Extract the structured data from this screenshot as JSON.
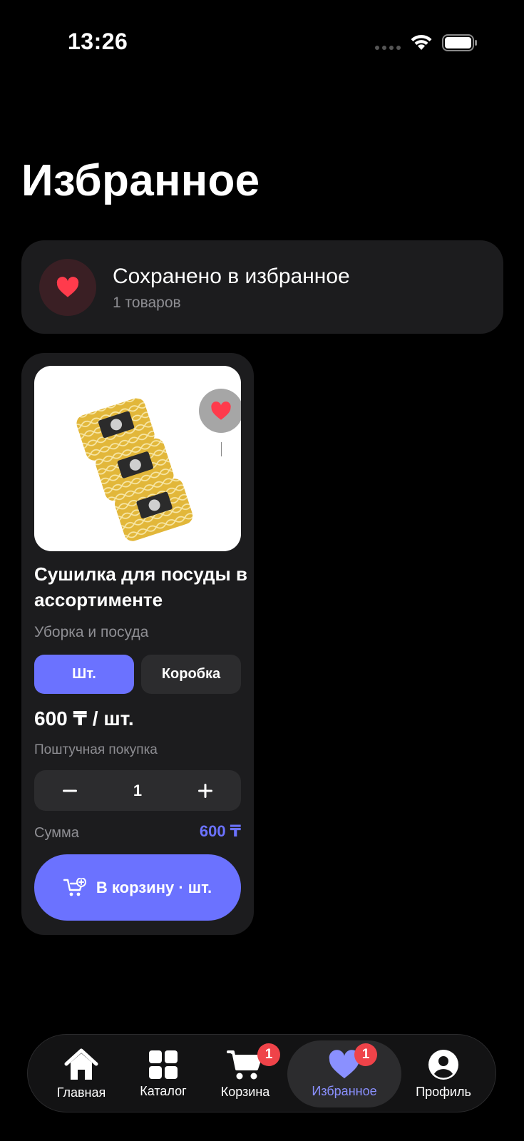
{
  "status": {
    "time": "13:26"
  },
  "page": {
    "title": "Избранное"
  },
  "summary": {
    "title": "Сохранено в избранное",
    "count": "1 товаров"
  },
  "product": {
    "name": "Сушилка для посуды в ассортименте",
    "category": "Уборка и посуда",
    "units": {
      "piece": "Шт.",
      "box": "Коробка",
      "selected": "piece"
    },
    "price": "600 ₸ / шт.",
    "purchase_note": "Поштучная покупка",
    "quantity": "1",
    "sum_label": "Сумма",
    "sum_value": "600 ₸",
    "cart_button": "В корзину · шт."
  },
  "tabbar": {
    "items": [
      {
        "label": "Главная",
        "icon": "home-icon"
      },
      {
        "label": "Каталог",
        "icon": "grid-icon"
      },
      {
        "label": "Корзина",
        "icon": "cart-icon",
        "badge": "1"
      },
      {
        "label": "Избранное",
        "icon": "heart-icon",
        "badge": "1",
        "active": true
      },
      {
        "label": "Профиль",
        "icon": "profile-icon"
      }
    ]
  },
  "colors": {
    "accent": "#6b72ff",
    "favorite": "#ff3b4c",
    "badge": "#ef4349",
    "card": "#1c1c1e"
  }
}
